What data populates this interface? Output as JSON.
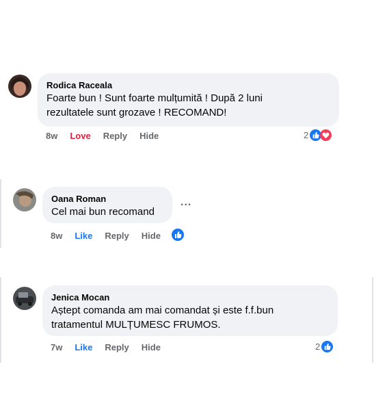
{
  "comments": [
    {
      "author": "Rodica Raceala",
      "text_lines": [
        "Foarte bun ! Sunt foarte mulțumită ! După 2 luni",
        "rezultatele sunt grozave ! RECOMAND!"
      ],
      "time": "8w",
      "reaction_action": "Love",
      "reply": "Reply",
      "hide": "Hide",
      "reaction_count": "2",
      "reactions": [
        "like-icon",
        "love-icon"
      ]
    },
    {
      "author": "Oana Roman",
      "text_lines": [
        "Cel mai bun recomand"
      ],
      "time": "8w",
      "reaction_action": "Like",
      "reply": "Reply",
      "hide": "Hide",
      "reaction_count": "",
      "reactions": [
        "like-icon"
      ],
      "more": "..."
    },
    {
      "author": "Jenica Mocan",
      "text_lines": [
        "Aștept comanda am mai comandat și este f.f.bun",
        "tratamentul MULȚUMESC FRUMOS."
      ],
      "time": "7w",
      "reaction_action": "Like",
      "reply": "Reply",
      "hide": "Hide",
      "reaction_count": "2",
      "reactions": [
        "like-icon"
      ]
    }
  ],
  "colors": {
    "bubble": "#f0f2f5",
    "like": "#1877f2",
    "love": "#e41e3f",
    "muted": "#65676b"
  }
}
